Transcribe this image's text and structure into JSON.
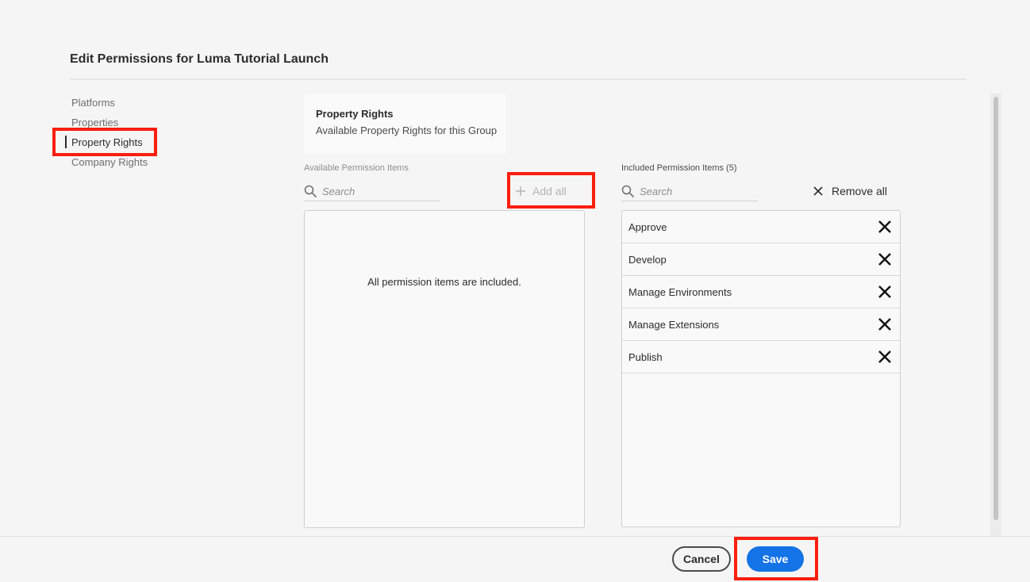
{
  "dialog": {
    "title": "Edit Permissions for Luma Tutorial Launch"
  },
  "sidebar": {
    "items": [
      {
        "label": "Platforms",
        "active": false
      },
      {
        "label": "Properties",
        "active": false
      },
      {
        "label": "Property Rights",
        "active": true
      },
      {
        "label": "Company Rights",
        "active": false
      }
    ]
  },
  "info_card": {
    "heading": "Property Rights",
    "subtext": "Available Property Rights for this Group"
  },
  "available": {
    "label": "Available Permission Items",
    "search_placeholder": "Search",
    "add_all_label": "Add all",
    "empty_message": "All permission items are included."
  },
  "included": {
    "label": "Included Permission Items (5)",
    "search_placeholder": "Search",
    "remove_all_label": "Remove all",
    "items": [
      "Approve",
      "Develop",
      "Manage Environments",
      "Manage Extensions",
      "Publish"
    ]
  },
  "footer": {
    "cancel_label": "Cancel",
    "save_label": "Save"
  },
  "colors": {
    "accent": "#1473e6",
    "highlight": "#fa1e0e"
  },
  "icons": [
    "search-icon",
    "plus-icon",
    "close-icon"
  ]
}
